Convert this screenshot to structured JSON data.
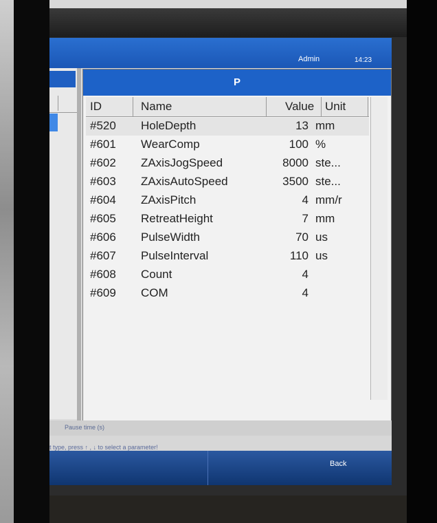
{
  "header": {
    "user": "Admin",
    "time": "14:23"
  },
  "panel": {
    "title": "P"
  },
  "table": {
    "columns": {
      "id": "ID",
      "name": "Name",
      "value": "Value",
      "unit": "Unit"
    },
    "rows": [
      {
        "id": "#520",
        "name": "HoleDepth",
        "value": "13",
        "unit": "mm"
      },
      {
        "id": "#601",
        "name": "WearComp",
        "value": "100",
        "unit": "%"
      },
      {
        "id": "#602",
        "name": "ZAxisJogSpeed",
        "value": "8000",
        "unit": "ste..."
      },
      {
        "id": "#603",
        "name": "ZAxisAutoSpeed",
        "value": "3500",
        "unit": "ste..."
      },
      {
        "id": "#604",
        "name": "ZAxisPitch",
        "value": "4",
        "unit": "mm/r"
      },
      {
        "id": "#605",
        "name": "RetreatHeight",
        "value": "7",
        "unit": "mm"
      },
      {
        "id": "#606",
        "name": "PulseWidth",
        "value": "70",
        "unit": "us"
      },
      {
        "id": "#607",
        "name": "PulseInterval",
        "value": "110",
        "unit": "us"
      },
      {
        "id": "#608",
        "name": "Count",
        "value": "4",
        "unit": ""
      },
      {
        "id": "#609",
        "name": "COM",
        "value": "4",
        "unit": ""
      }
    ]
  },
  "status": {
    "text": "Pause time (s)"
  },
  "hint": {
    "text": "t type, press ↑ , ↓ to select a parameter!"
  },
  "softkeys": {
    "back": "Back"
  }
}
